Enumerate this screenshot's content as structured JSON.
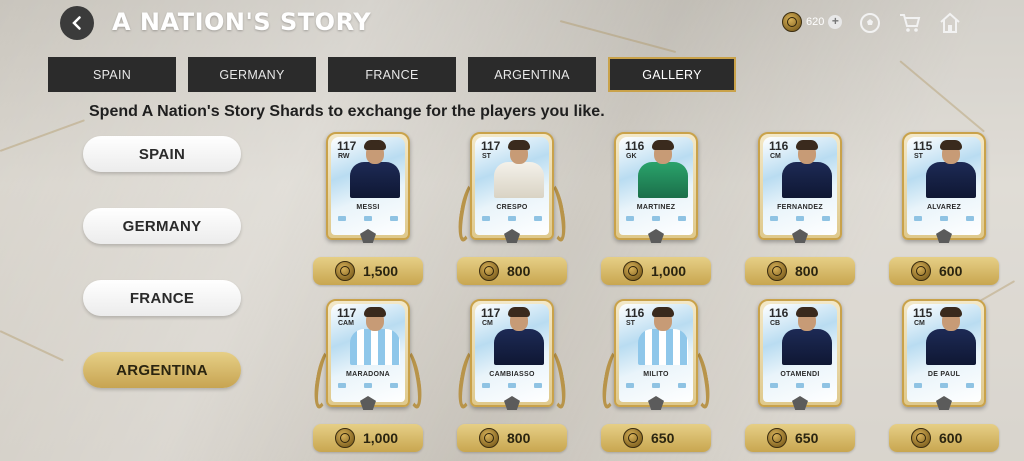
{
  "header": {
    "title": "A NATION'S STORY",
    "currency_amount": "620"
  },
  "tabs": [
    {
      "label": "SPAIN",
      "active": false
    },
    {
      "label": "GERMANY",
      "active": false
    },
    {
      "label": "FRANCE",
      "active": false
    },
    {
      "label": "ARGENTINA",
      "active": false
    },
    {
      "label": "GALLERY",
      "active": true
    }
  ],
  "subtitle": "Spend A Nation's Story Shards to exchange for the players you like.",
  "sidebar": [
    {
      "label": "SPAIN",
      "active": false
    },
    {
      "label": "GERMANY",
      "active": false
    },
    {
      "label": "FRANCE",
      "active": false
    },
    {
      "label": "ARGENTINA",
      "active": true
    }
  ],
  "players": [
    {
      "rating": "117",
      "position": "RW",
      "name": "MESSI",
      "price": "1,500",
      "kit": "dark",
      "wreath": false
    },
    {
      "rating": "117",
      "position": "ST",
      "name": "CRESPO",
      "price": "800",
      "kit": "white",
      "wreath": true
    },
    {
      "rating": "116",
      "position": "GK",
      "name": "MARTINEZ",
      "price": "1,000",
      "kit": "green",
      "wreath": false
    },
    {
      "rating": "116",
      "position": "CM",
      "name": "FERNANDEZ",
      "price": "800",
      "kit": "dark",
      "wreath": false
    },
    {
      "rating": "115",
      "position": "ST",
      "name": "ALVAREZ",
      "price": "600",
      "kit": "dark",
      "wreath": false
    },
    {
      "rating": "117",
      "position": "CAM",
      "name": "MARADONA",
      "price": "1,000",
      "kit": "stripes",
      "wreath": true
    },
    {
      "rating": "117",
      "position": "CM",
      "name": "CAMBIASSO",
      "price": "800",
      "kit": "dark",
      "wreath": true
    },
    {
      "rating": "116",
      "position": "ST",
      "name": "MILITO",
      "price": "650",
      "kit": "stripes",
      "wreath": true
    },
    {
      "rating": "116",
      "position": "CB",
      "name": "OTAMENDI",
      "price": "650",
      "kit": "dark",
      "wreath": false
    },
    {
      "rating": "115",
      "position": "CM",
      "name": "DE PAUL",
      "price": "600",
      "kit": "dark",
      "wreath": false
    }
  ]
}
